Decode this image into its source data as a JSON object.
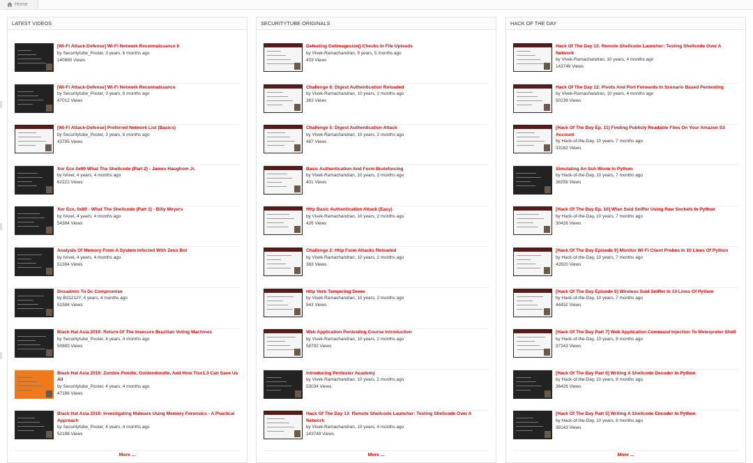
{
  "breadcrumb": {
    "home_label": "Home"
  },
  "more_label": "More ...",
  "columns": [
    {
      "header": "LATEST VIDEOS",
      "items": [
        {
          "title": "[Wi-Fi Attack-Defense] Wi-Fi Network Reconnaissance Ii",
          "meta": "by Securitytube_Poster, 3 years, 6 months ago",
          "views": "140880 Views",
          "thumb": "dark"
        },
        {
          "title": "[Wi-Fi Attack-Defense] Wi-Fi Network Reconnaissance",
          "meta": "by Securitytube_Poster, 3 years, 6 months ago",
          "views": "47012 Views",
          "thumb": "dark"
        },
        {
          "title": "[Wi-Fi Attack-Defense] Preferred Network List (Basics)",
          "meta": "by Securitytube_Poster, 3 years, 6 months ago",
          "views": "43795 Views",
          "thumb": "light"
        },
        {
          "title": "Xor Ecx 0x00 What The Shellcode (Part 2) - James Haughom Jr.",
          "meta": "by hAxel, 4 years, 4 months ago",
          "views": "62222 Views",
          "thumb": "dark"
        },
        {
          "title": "Xor Ecx, 0x00 - What The Shellcode (Part 1) - Billy Meyers",
          "meta": "by hAxel, 4 years, 4 months ago",
          "views": "54384 Views",
          "thumb": "dark"
        },
        {
          "title": "Analysis Of Memory From A System Infected With Zeus Bot",
          "meta": "by hAxel, 4 years, 4 months ago",
          "views": "51394 Views",
          "thumb": "dark"
        },
        {
          "title": "Dnsadmin To Dc Compromise",
          "meta": "by B31212Y, 4 years, 4 months ago",
          "views": "51584 Views",
          "thumb": "dark"
        },
        {
          "title": "Black Hat Asia 2019: Return Of The Insecure Brazilian Voting Machines",
          "meta": "by Securitytube_Poster, 4 years, 4 months ago",
          "views": "50883 Views",
          "thumb": "dark"
        },
        {
          "title": "Black Hat Asia 2019: Zombie Poodle, Goldendoodle, And How Tlsv1.3 Can Save Us All",
          "meta": "by Securitytube_Poster, 4 years, 4 months ago",
          "views": "47186 Views",
          "thumb": "orange"
        },
        {
          "title": "Black Hat Asia 2019: Investigating Malware Using Memory Forensics - A Practical Approach",
          "meta": "by Securitytube_Poster, 4 years, 4 months ago",
          "views": "52198 Views",
          "thumb": "dark"
        }
      ]
    },
    {
      "header": "SECURITYTUBE ORIGINALS",
      "items": [
        {
          "title": "Defeating Getimagesize() Checks In File Uploads",
          "meta": "by Vivek-Ramachandran, 9 years, 5 months ago",
          "views": "433 Views",
          "thumb": "light"
        },
        {
          "title": "Challenge 6: Digest Authentication Reloaded",
          "meta": "by Vivek-Ramachandran, 10 years, 2 months ago",
          "views": "383 Views",
          "thumb": "light"
        },
        {
          "title": "Challenge 5: Digest Authentication Attack",
          "meta": "by Vivek-Ramachandran, 10 years, 2 months ago",
          "views": "487 Views",
          "thumb": "light"
        },
        {
          "title": "Basic Authentication And Form Bruteforcing",
          "meta": "by Vivek-Ramachandran, 10 years, 2 months ago",
          "views": "401 Views",
          "thumb": "light"
        },
        {
          "title": "Http Basic Authentication Attack (Easy)",
          "meta": "by Vivek-Ramachandran, 10 years, 2 months ago",
          "views": "426 Views",
          "thumb": "light"
        },
        {
          "title": "Challenge 2: Http Form Attacks Reloaded",
          "meta": "by Vivek-Ramachandran, 10 years, 2 months ago",
          "views": "383 Views",
          "thumb": "light"
        },
        {
          "title": "Http Verb Tampering Demo",
          "meta": "by Vivek-Ramachandran, 10 years, 2 months ago",
          "views": "543 Views",
          "thumb": "light"
        },
        {
          "title": "Web Application Pentesting Course Introduction",
          "meta": "by Vivek-Ramachandran, 10 years, 2 months ago",
          "views": "58792 Views",
          "thumb": "light"
        },
        {
          "title": "Introducing Pentester Academy",
          "meta": "by Vivek-Ramachandran, 10 years, 2 months ago",
          "views": "53034 Views",
          "thumb": "dark"
        },
        {
          "title": "Hack Of The Day 13: Remote Shellcode Launcher: Testing Shellcode Over A Network",
          "meta": "by Vivek-Ramachandran, 10 years, 4 months ago",
          "views": "143749 Views",
          "thumb": "light"
        }
      ]
    },
    {
      "header": "HACK OF THE DAY",
      "items": [
        {
          "title": "Hack Of The Day 13: Remote Shellcode Launcher: Testing Shellcode Over A Network",
          "meta": "by Vivek-Ramachandran, 10 years, 4 months ago",
          "views": "143749 Views",
          "thumb": "light"
        },
        {
          "title": "Hack Of The Day 12: Pivots And Port Forwards In Scenario Based Pentesting",
          "meta": "by Vivek-Ramachandran, 10 years, 4 months ago",
          "views": "50239 Views",
          "thumb": "light"
        },
        {
          "title": "[Hack Of The Day Ep. 11] Finding Publicly Readable Files On Your Amazon S3 Account",
          "meta": "by Hack-of-the-Day, 10 years, 7 months ago",
          "views": "33182 Views",
          "thumb": "light"
        },
        {
          "title": "Simulating An Ssh Worm In Python",
          "meta": "by Hack-of-the-Day, 10 years, 7 months ago",
          "views": "38256 Views",
          "thumb": "dark"
        },
        {
          "title": "[Hack Of The Day Ep. 10] Wlan Ssid Sniffer Using Raw Sockets In Python",
          "meta": "by Hack-of-the-Day, 10 years, 7 months ago",
          "views": "30426 Views",
          "thumb": "light"
        },
        {
          "title": "[Hack Of The Day Episode 9] Monitor Wi-Fi Client Probes In 10 Lines Of Python",
          "meta": "by Hack-of-the-Day, 10 years, 7 months ago",
          "views": "42820 Views",
          "thumb": "light"
        },
        {
          "title": "[Hack Of The Day Episode 8] Wireless Ssid Sniffer In 10 Lines Of Python",
          "meta": "by Hack-of-the-Day, 10 years, 7 months ago",
          "views": "44432 Views",
          "thumb": "light"
        },
        {
          "title": "[Hack Of The Day Part 7] Web Application Command Injection To Meterpreter Shell",
          "meta": "by Hack-of-the-Day, 10 years, 8 months ago",
          "views": "37243 Views",
          "thumb": "light"
        },
        {
          "title": "[Hack Of The Day Part 6] Writing A Shellcode Decoder In Python",
          "meta": "by Hack-of-the-Day, 10 years, 8 months ago",
          "views": "36426 Views",
          "thumb": "dark"
        },
        {
          "title": "[Hack Of The Day Part 5] Writing A Shellcode Encoder In Python",
          "meta": "by Hack-of-the-Day, 10 years, 8 months ago",
          "views": "39143 Views",
          "thumb": "dark"
        }
      ]
    }
  ]
}
